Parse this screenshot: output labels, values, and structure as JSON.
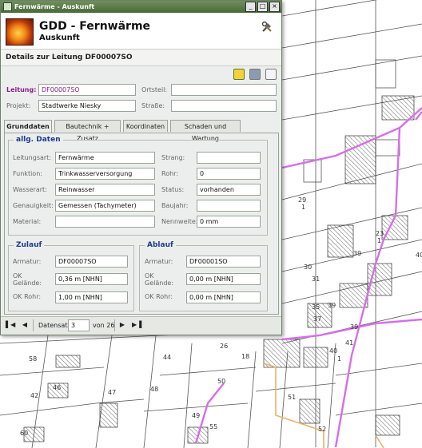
{
  "window": {
    "title": "Fernwärme - Auskunft"
  },
  "header": {
    "title": "GDD - Fernwärme",
    "subtitle": "Auskunft"
  },
  "details_title": "Details zur Leitung DF00007SO",
  "top_form": {
    "leitung": {
      "label": "Leitung:",
      "value": "DF00007SO"
    },
    "projekt": {
      "label": "Projekt:",
      "value": "Stadtwerke Niesky"
    },
    "ortsteil": {
      "label": "Ortsteil:",
      "value": ""
    },
    "strasse": {
      "label": "Straße:",
      "value": ""
    }
  },
  "tabs": [
    "Grunddaten",
    "Bautechnik + Zusatz",
    "Koordinaten",
    "Schaden und Wartung"
  ],
  "allg": {
    "legend": "allg. Daten",
    "left": [
      {
        "label": "Leitungsart:",
        "value": "Fernwärme"
      },
      {
        "label": "Funktion:",
        "value": "Trinkwasserversorgung"
      },
      {
        "label": "Wasserart:",
        "value": "Reinwasser"
      },
      {
        "label": "Genauigkeit:",
        "value": "Gemessen (Tachymeter)"
      },
      {
        "label": "Material:",
        "value": ""
      }
    ],
    "right": [
      {
        "label": "Strang:",
        "value": ""
      },
      {
        "label": "Rohr:",
        "value": "0"
      },
      {
        "label": "Status:",
        "value": "vorhanden"
      },
      {
        "label": "Baujahr:",
        "value": ""
      },
      {
        "label": "Nennweite:",
        "value": "0 mm"
      }
    ]
  },
  "zulauf": {
    "legend": "Zulauf",
    "armatur": {
      "label": "Armatur:",
      "value": "DF00007SO"
    },
    "ok_gelaende": {
      "label1": "OK",
      "label2": "Gelände:",
      "value": "0,36 m [NHN]"
    },
    "ok_rohr": {
      "label": "OK Rohr:",
      "value": "1,00 m [NHN]"
    }
  },
  "ablauf": {
    "legend": "Ablauf",
    "armatur": {
      "label": "Armatur:",
      "value": "DF00001SO"
    },
    "ok_gelaende": {
      "label1": "OK",
      "label2": "Gelände:",
      "value": "0,00 m [NHN]"
    },
    "ok_rohr": {
      "label": "OK Rohr:",
      "value": "0,00 m [NHN]"
    }
  },
  "pager": {
    "label": "Datensatz",
    "value": "3",
    "total": "von 26"
  },
  "map": {
    "labels": [
      "29",
      "1",
      "23",
      "1",
      "39",
      "39",
      "41",
      "30",
      "31",
      "35",
      "37",
      "39",
      "40",
      "1",
      "44",
      "58",
      "42",
      "46",
      "47",
      "48",
      "50",
      "51",
      "52",
      "49",
      "60",
      "55",
      "26",
      "18",
      "40"
    ]
  },
  "colors": {
    "pipe": "#d66fe8",
    "road": "#e8b36a",
    "title_bar": "#48693a"
  }
}
